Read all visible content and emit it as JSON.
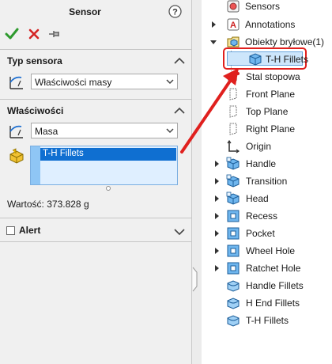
{
  "property_manager": {
    "title": "Sensor",
    "sections": {
      "sensor_type": {
        "title": "Typ sensora",
        "combo_value": "Właściwości masy"
      },
      "properties": {
        "title": "Właściwości",
        "combo_value": "Masa",
        "selection_items": [
          "T-H Fillets"
        ],
        "value_text": "Wartość: 373.828 g"
      },
      "alert": {
        "label": "Alert"
      }
    }
  },
  "feature_tree": {
    "items": [
      {
        "label": "Sensors",
        "icon": "sensors-icon"
      },
      {
        "label": "Annotations",
        "icon": "annotations-icon"
      },
      {
        "label": "Obiekty bryłowe(1)",
        "icon": "solid-bodies-icon"
      },
      {
        "label": "T-H Fillets",
        "icon": "body-icon"
      },
      {
        "label": "Stal stopowa",
        "icon": "material-icon"
      },
      {
        "label": "Front Plane",
        "icon": "plane-icon"
      },
      {
        "label": "Top Plane",
        "icon": "plane-icon"
      },
      {
        "label": "Right Plane",
        "icon": "plane-icon"
      },
      {
        "label": "Origin",
        "icon": "origin-icon"
      },
      {
        "label": "Handle",
        "icon": "extrude-icon"
      },
      {
        "label": "Transition",
        "icon": "extrude-icon"
      },
      {
        "label": "Head",
        "icon": "extrude-icon"
      },
      {
        "label": "Recess",
        "icon": "cut-icon"
      },
      {
        "label": "Pocket",
        "icon": "cut-icon"
      },
      {
        "label": "Wheel Hole",
        "icon": "cut-icon"
      },
      {
        "label": "Ratchet Hole",
        "icon": "cut-icon"
      },
      {
        "label": "Handle Fillets",
        "icon": "fillet-icon"
      },
      {
        "label": "H End Fillets",
        "icon": "fillet-icon"
      },
      {
        "label": "T-H Fillets",
        "icon": "fillet-icon"
      }
    ]
  },
  "colors": {
    "accent_blue": "#0f6fd1",
    "highlight_red": "#e0201e",
    "ok_green": "#2e9a2e",
    "cancel_red": "#d42323"
  }
}
